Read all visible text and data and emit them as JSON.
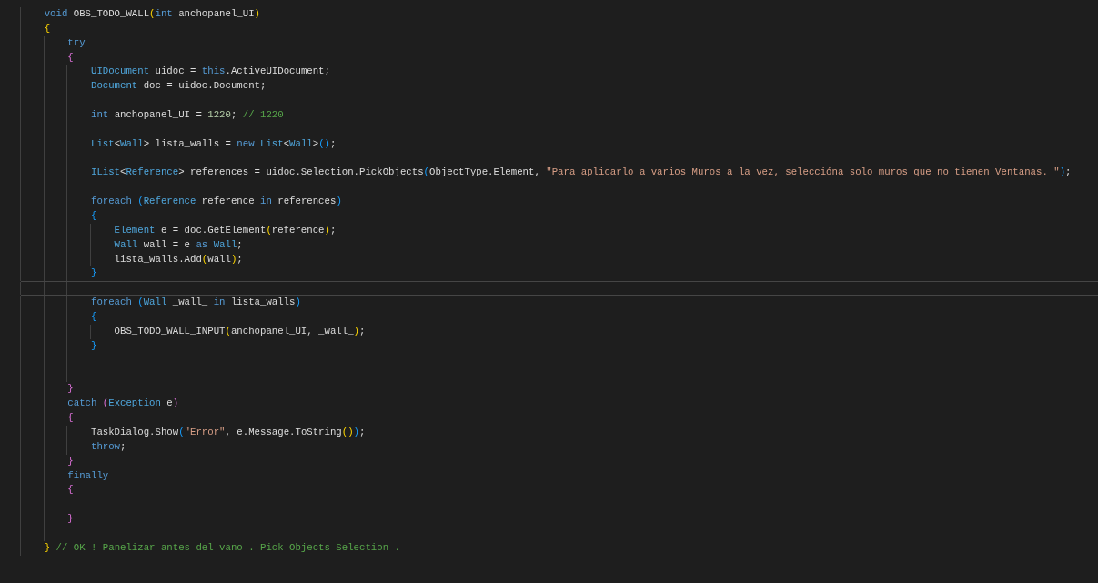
{
  "editor": {
    "lines": [
      {
        "current": false,
        "tokens": [
          {
            "text": "    void",
            "kind": "kw"
          },
          {
            "text": " OBS_TODO_WALL",
            "kind": "plain"
          },
          {
            "text": "(",
            "kind": "p1"
          },
          {
            "text": "int",
            "kind": "kw"
          },
          {
            "text": " anchopanel_UI",
            "kind": "plain"
          },
          {
            "text": ")",
            "kind": "p1"
          }
        ]
      },
      {
        "current": false,
        "tokens": [
          {
            "text": "    {",
            "kind": "p1"
          }
        ]
      },
      {
        "current": false,
        "tokens": [
          {
            "text": "        try",
            "kind": "kw"
          }
        ]
      },
      {
        "current": false,
        "tokens": [
          {
            "text": "        {",
            "kind": "p2"
          }
        ]
      },
      {
        "current": false,
        "tokens": [
          {
            "text": "            UIDocument",
            "kind": "type"
          },
          {
            "text": " uidoc = ",
            "kind": "plain"
          },
          {
            "text": "this",
            "kind": "kw"
          },
          {
            "text": ".ActiveUIDocument;",
            "kind": "plain"
          }
        ]
      },
      {
        "current": false,
        "tokens": [
          {
            "text": "            Document",
            "kind": "type"
          },
          {
            "text": " doc = uidoc.Document;",
            "kind": "plain"
          }
        ]
      },
      {
        "current": false
      },
      {
        "current": false,
        "tokens": [
          {
            "text": "            int",
            "kind": "kw"
          },
          {
            "text": " anchopanel_UI = ",
            "kind": "plain"
          },
          {
            "text": "1220",
            "kind": "num"
          },
          {
            "text": "; ",
            "kind": "plain"
          },
          {
            "text": "// 1220",
            "kind": "comment"
          }
        ]
      },
      {
        "current": false
      },
      {
        "current": false,
        "tokens": [
          {
            "text": "            List",
            "kind": "type"
          },
          {
            "text": "<",
            "kind": "plain"
          },
          {
            "text": "Wall",
            "kind": "type"
          },
          {
            "text": "> lista_walls = ",
            "kind": "plain"
          },
          {
            "text": "new",
            "kind": "kw"
          },
          {
            "text": " List",
            "kind": "type"
          },
          {
            "text": "<",
            "kind": "plain"
          },
          {
            "text": "Wall",
            "kind": "type"
          },
          {
            "text": ">",
            "kind": "plain"
          },
          {
            "text": "()",
            "kind": "p3"
          },
          {
            "text": ";",
            "kind": "plain"
          }
        ]
      },
      {
        "current": false
      },
      {
        "current": false,
        "tokens": [
          {
            "text": "            IList",
            "kind": "type"
          },
          {
            "text": "<",
            "kind": "plain"
          },
          {
            "text": "Reference",
            "kind": "type"
          },
          {
            "text": "> references = uidoc.Selection.PickObjects",
            "kind": "plain"
          },
          {
            "text": "(",
            "kind": "p3"
          },
          {
            "text": "ObjectType.Element, ",
            "kind": "plain"
          },
          {
            "text": "\"Para aplicarlo a varios Muros a la vez, seleccióna solo muros que no tienen Ventanas. \"",
            "kind": "str"
          },
          {
            "text": ")",
            "kind": "p3"
          },
          {
            "text": ";",
            "kind": "plain"
          }
        ]
      },
      {
        "current": false
      },
      {
        "current": false,
        "tokens": [
          {
            "text": "            foreach",
            "kind": "kw"
          },
          {
            "text": " (",
            "kind": "p3"
          },
          {
            "text": "Reference",
            "kind": "type"
          },
          {
            "text": " reference ",
            "kind": "plain"
          },
          {
            "text": "in",
            "kind": "kw"
          },
          {
            "text": " references",
            "kind": "plain"
          },
          {
            "text": ")",
            "kind": "p3"
          }
        ]
      },
      {
        "current": false,
        "tokens": [
          {
            "text": "            {",
            "kind": "p3"
          }
        ]
      },
      {
        "current": false,
        "tokens": [
          {
            "text": "                Element",
            "kind": "type"
          },
          {
            "text": " e = doc.GetElement",
            "kind": "plain"
          },
          {
            "text": "(",
            "kind": "p1"
          },
          {
            "text": "reference",
            "kind": "plain"
          },
          {
            "text": ")",
            "kind": "p1"
          },
          {
            "text": ";",
            "kind": "plain"
          }
        ]
      },
      {
        "current": false,
        "tokens": [
          {
            "text": "                Wall",
            "kind": "type"
          },
          {
            "text": " wall = e ",
            "kind": "plain"
          },
          {
            "text": "as",
            "kind": "kw"
          },
          {
            "text": " Wall",
            "kind": "type"
          },
          {
            "text": ";",
            "kind": "plain"
          }
        ]
      },
      {
        "current": false,
        "tokens": [
          {
            "text": "                lista_walls.Add",
            "kind": "plain"
          },
          {
            "text": "(",
            "kind": "p1"
          },
          {
            "text": "wall",
            "kind": "plain"
          },
          {
            "text": ")",
            "kind": "p1"
          },
          {
            "text": ";",
            "kind": "plain"
          }
        ]
      },
      {
        "current": false,
        "tokens": [
          {
            "text": "            }",
            "kind": "p3"
          }
        ]
      },
      {
        "current": true
      },
      {
        "current": false,
        "tokens": [
          {
            "text": "            foreach",
            "kind": "kw"
          },
          {
            "text": " (",
            "kind": "p3"
          },
          {
            "text": "Wall",
            "kind": "type"
          },
          {
            "text": " _wall_ ",
            "kind": "plain"
          },
          {
            "text": "in",
            "kind": "kw"
          },
          {
            "text": " lista_walls",
            "kind": "plain"
          },
          {
            "text": ")",
            "kind": "p3"
          }
        ]
      },
      {
        "current": false,
        "tokens": [
          {
            "text": "            {",
            "kind": "p3"
          }
        ]
      },
      {
        "current": false,
        "tokens": [
          {
            "text": "                OBS_TODO_WALL_INPUT",
            "kind": "plain"
          },
          {
            "text": "(",
            "kind": "p1"
          },
          {
            "text": "anchopanel_UI, _wall_",
            "kind": "plain"
          },
          {
            "text": ")",
            "kind": "p1"
          },
          {
            "text": ";",
            "kind": "plain"
          }
        ]
      },
      {
        "current": false,
        "tokens": [
          {
            "text": "            }",
            "kind": "p3"
          }
        ]
      },
      {
        "current": false
      },
      {
        "current": false
      },
      {
        "current": false,
        "tokens": [
          {
            "text": "        }",
            "kind": "p2"
          }
        ]
      },
      {
        "current": false,
        "tokens": [
          {
            "text": "        catch",
            "kind": "kw"
          },
          {
            "text": " (",
            "kind": "p2"
          },
          {
            "text": "Exception",
            "kind": "type"
          },
          {
            "text": " e",
            "kind": "plain"
          },
          {
            "text": ")",
            "kind": "p2"
          }
        ]
      },
      {
        "current": false,
        "tokens": [
          {
            "text": "        {",
            "kind": "p2"
          }
        ]
      },
      {
        "current": false,
        "tokens": [
          {
            "text": "            TaskDialog.Show",
            "kind": "plain"
          },
          {
            "text": "(",
            "kind": "p3"
          },
          {
            "text": "\"Error\"",
            "kind": "str"
          },
          {
            "text": ", e.Message.ToString",
            "kind": "plain"
          },
          {
            "text": "()",
            "kind": "p1"
          },
          {
            "text": ")",
            "kind": "p3"
          },
          {
            "text": ";",
            "kind": "plain"
          }
        ]
      },
      {
        "current": false,
        "tokens": [
          {
            "text": "            throw",
            "kind": "kw"
          },
          {
            "text": ";",
            "kind": "plain"
          }
        ]
      },
      {
        "current": false,
        "tokens": [
          {
            "text": "        }",
            "kind": "p2"
          }
        ]
      },
      {
        "current": false,
        "tokens": [
          {
            "text": "        finally",
            "kind": "kw"
          }
        ]
      },
      {
        "current": false,
        "tokens": [
          {
            "text": "        {",
            "kind": "p2"
          }
        ]
      },
      {
        "current": false
      },
      {
        "current": false,
        "tokens": [
          {
            "text": "        }",
            "kind": "p2"
          }
        ]
      },
      {
        "current": false
      },
      {
        "current": false,
        "tokens": [
          {
            "text": "    }",
            "kind": "p1"
          },
          {
            "text": " // OK ! Panelizar antes del vano . Pick Objects Selection .",
            "kind": "comment"
          }
        ]
      }
    ]
  }
}
